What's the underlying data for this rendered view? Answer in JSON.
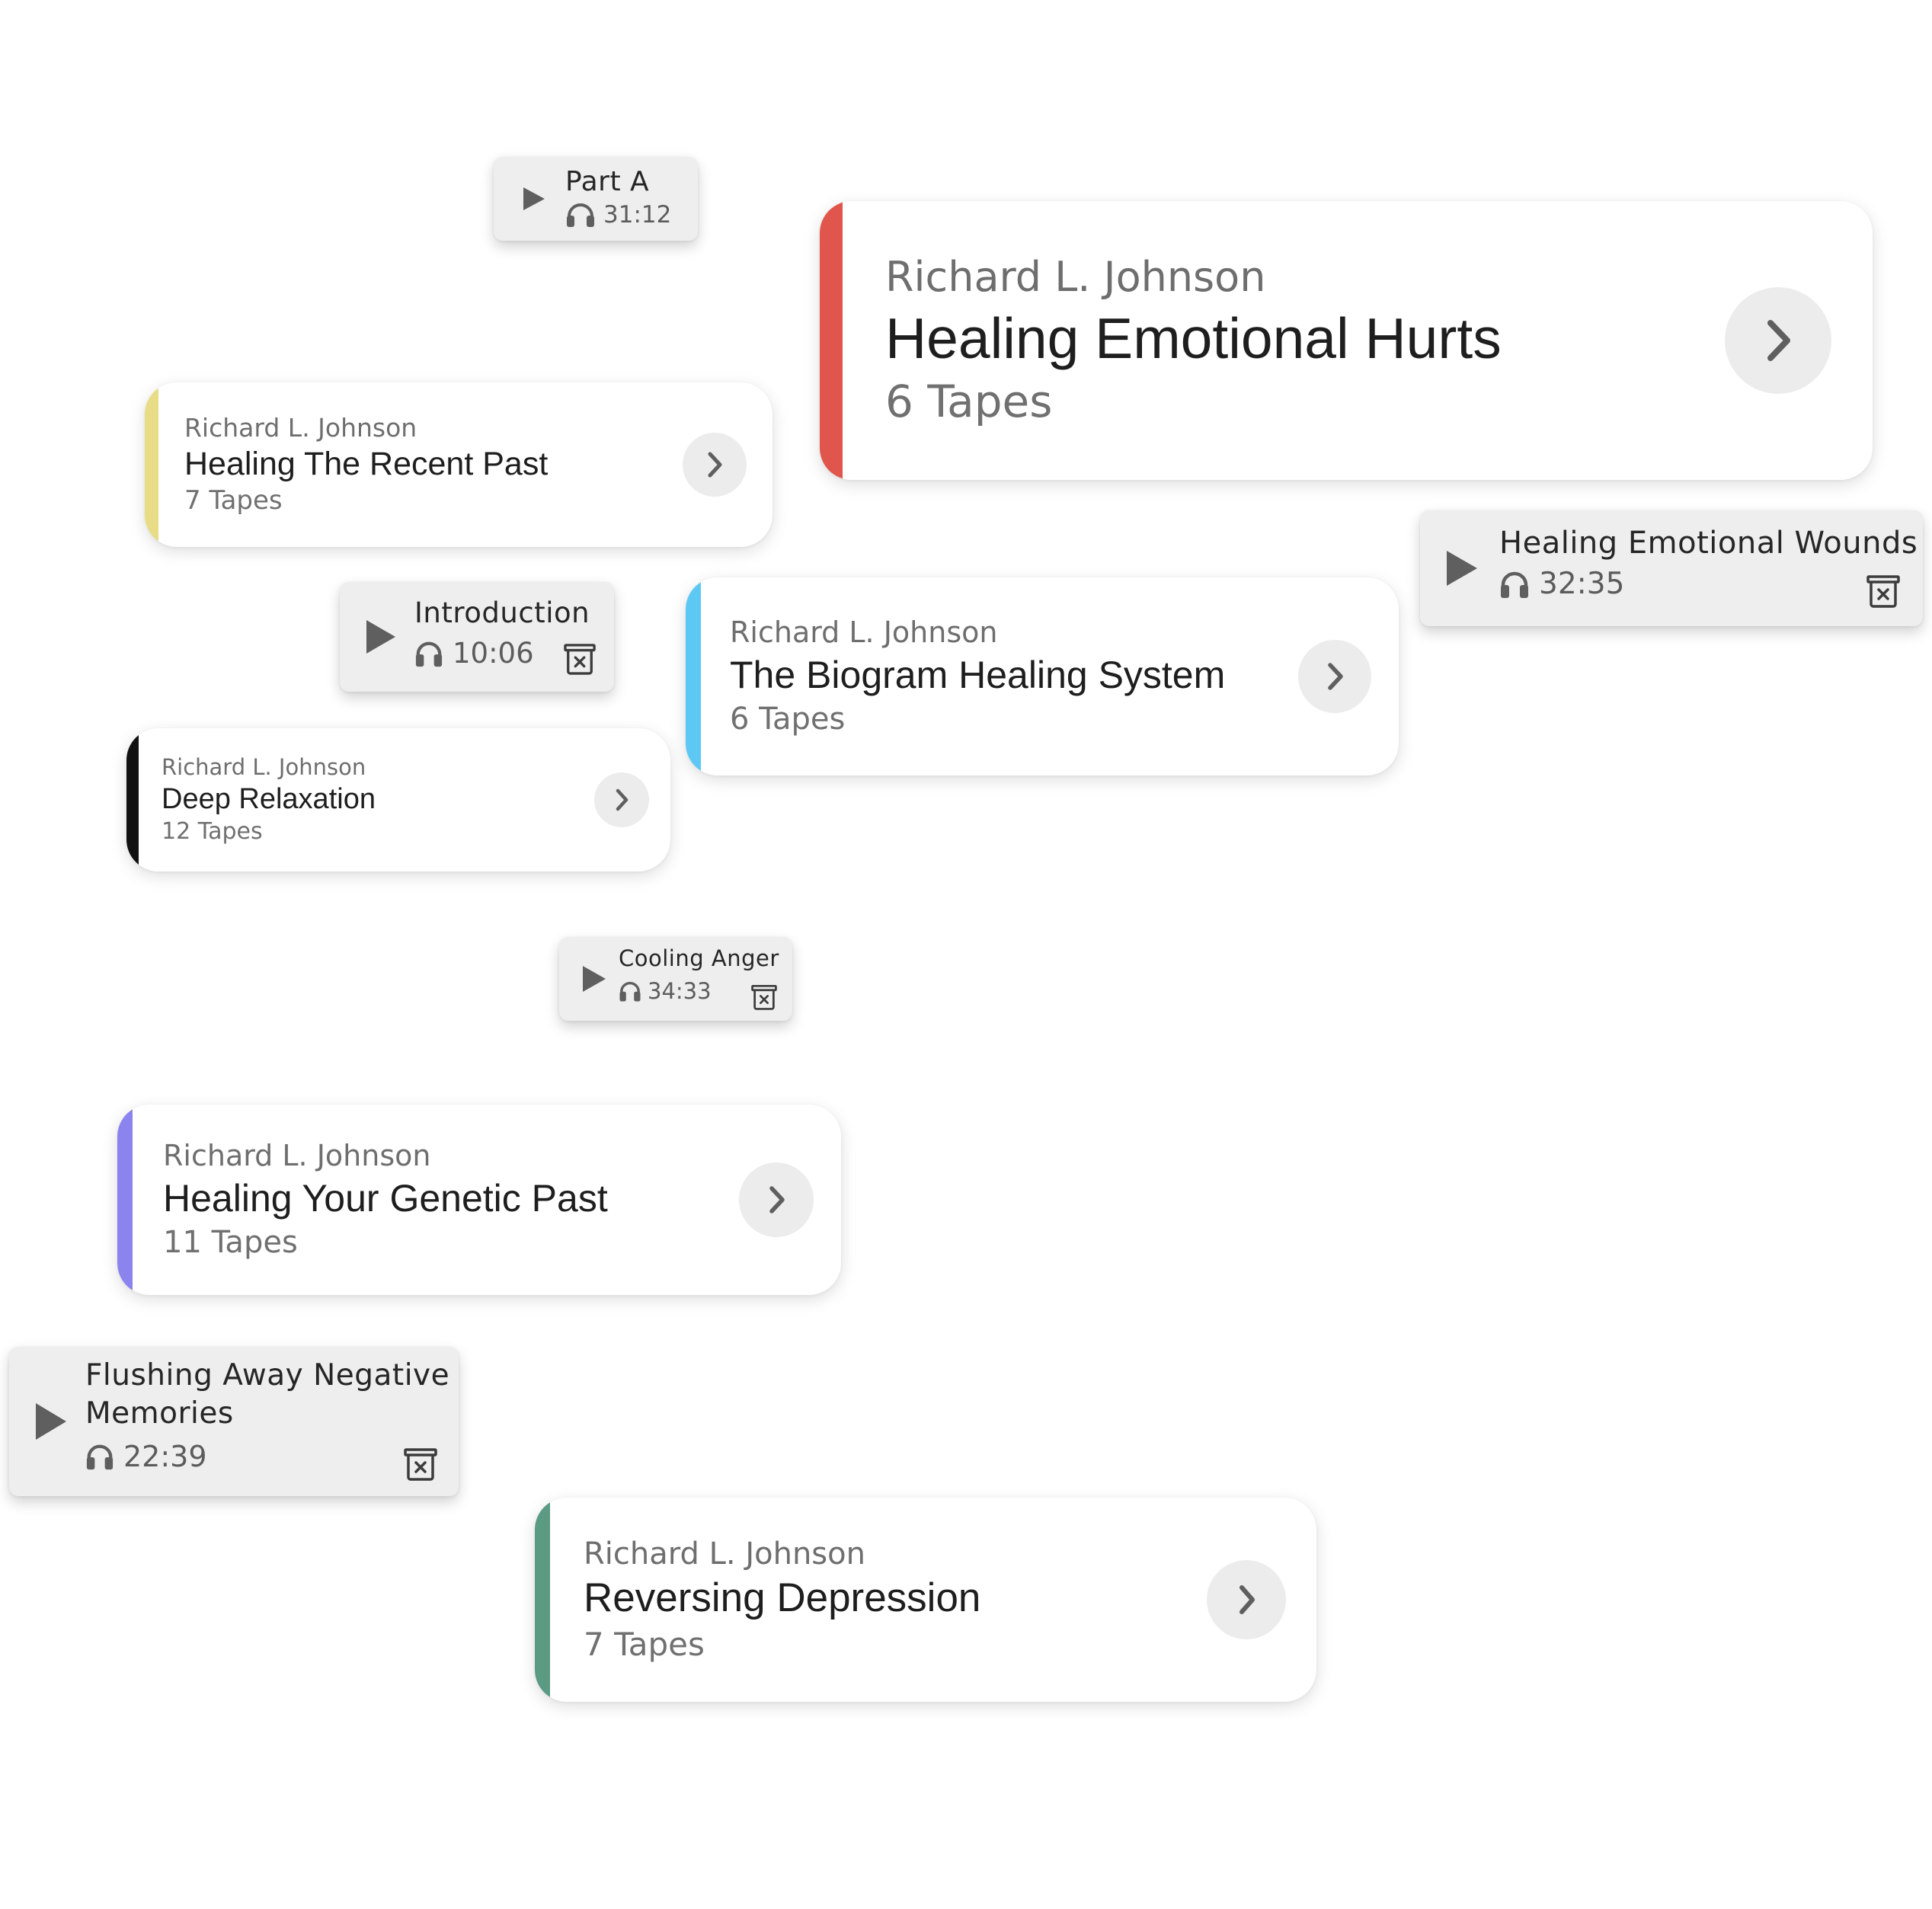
{
  "series": [
    {
      "id": "healing-emotional-hurts",
      "author": "Richard L. Johnson",
      "title": "Healing Emotional Hurts",
      "tapes": "6 Tapes",
      "accent": "#e0564c"
    },
    {
      "id": "healing-recent-past",
      "author": "Richard L. Johnson",
      "title": "Healing The Recent Past",
      "tapes": "7 Tapes",
      "accent": "#e8dc86"
    },
    {
      "id": "biogram-healing-system",
      "author": "Richard L. Johnson",
      "title": "The Biogram Healing System",
      "tapes": "6 Tapes",
      "accent": "#5ec8f4"
    },
    {
      "id": "deep-relaxation",
      "author": "Richard L. Johnson",
      "title": "Deep Relaxation",
      "tapes": "12 Tapes",
      "accent": "#111111"
    },
    {
      "id": "healing-genetic-past",
      "author": "Richard L. Johnson",
      "title": "Healing Your Genetic Past",
      "tapes": "11 Tapes",
      "accent": "#8b84ee"
    },
    {
      "id": "reversing-depression",
      "author": "Richard L. Johnson",
      "title": "Reversing Depression",
      "tapes": "7 Tapes",
      "accent": "#5b9a83"
    }
  ],
  "tapes": [
    {
      "id": "part-a",
      "title": "Part A",
      "duration": "31:12",
      "icons": [
        "play-icon",
        "headphones-icon"
      ]
    },
    {
      "id": "healing-emotional-wounds",
      "title": "Healing Emotional Wounds",
      "duration": "32:35",
      "icons": [
        "play-icon",
        "headphones-icon",
        "trash-icon"
      ]
    },
    {
      "id": "introduction",
      "title": "Introduction",
      "duration": "10:06",
      "icons": [
        "play-icon",
        "headphones-icon",
        "trash-icon"
      ]
    },
    {
      "id": "cooling-anger",
      "title": "Cooling Anger",
      "duration": "34:33",
      "icons": [
        "play-icon",
        "headphones-icon",
        "trash-icon"
      ]
    },
    {
      "id": "flushing-away",
      "title": "Flushing Away Negative Memories",
      "title_lines": [
        "Flushing Away Negative",
        "Memories"
      ],
      "duration": "22:39",
      "icons": [
        "play-icon",
        "headphones-icon",
        "trash-icon"
      ]
    }
  ],
  "colors": {
    "chip_bg": "#eeeeee",
    "card_bg": "#ffffff",
    "button_bg": "#ececec",
    "icon_gray": "#5f5f5f"
  }
}
